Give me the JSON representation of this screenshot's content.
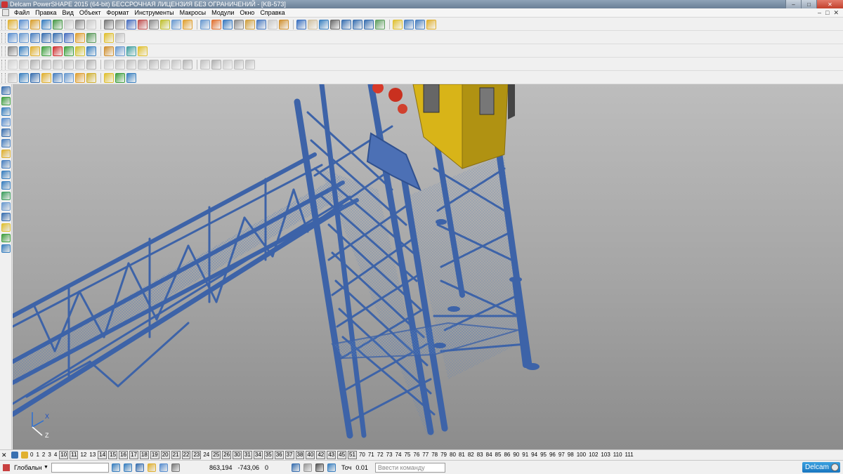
{
  "window": {
    "title": "Delcam PowerSHAPE 2015 (64-bit) БЕССРОЧНАЯ ЛИЦЕНЗИЯ БЕЗ ОГРАНИЧЕНИЙ - [KB-573]",
    "minimize": "–",
    "maximize": "□",
    "close": "✕"
  },
  "menu": {
    "items": [
      "Файл",
      "Правка",
      "Вид",
      "Объект",
      "Формат",
      "Инструменты",
      "Макросы",
      "Модули",
      "Окно",
      "Справка"
    ],
    "mdi": [
      "–",
      "□",
      "✕"
    ]
  },
  "toolbars": {
    "row1": [
      "#e0b030",
      "#5a8fd0",
      "#d9a030",
      "#3a7fc0",
      "#4a9a4a",
      "#c8c8c8",
      "#888",
      "#c8c8c8",
      "#777",
      "#999",
      "#4a70c0",
      "#c05050",
      "#8a8a8a",
      "#c0c030",
      "#6a9ad0",
      "#e0a030",
      "#6a9ad0",
      "#e07030",
      "#3a7ac0",
      "#8a8a8a",
      "#d0a040",
      "#4a7ac0",
      "#c8c8c8",
      "#d09030",
      "#3a70c0",
      "#d0c0a0",
      "#3a80c0",
      "#6a6a6a",
      "#3a70b0",
      "#3a70b0",
      "#3a70b0",
      "#60a060",
      "#e0c030",
      "#4a80c0",
      "#4a80c0",
      "#e0b030"
    ],
    "row2": [
      "#5a8fd0",
      "#6a9ad0",
      "#4a80c0",
      "#3a70b0",
      "#3a70b0",
      "#4a70c0",
      "#e0a030",
      "#5a9a5a",
      "#e0c030",
      "#c0c0c0"
    ],
    "row3": [
      "#888",
      "#3a80c0",
      "#e0b030",
      "#40a040",
      "#d03030",
      "#40a040",
      "#d0c030",
      "#3a80c0",
      "#d09030",
      "#6a9ad0",
      "#40a0a0",
      "#e0c030"
    ],
    "row4": [
      "#d0d0d0",
      "#c8c8c8",
      "#b0b0b0",
      "#b8b8b8",
      "#c0c0c0",
      "#bdbdbd",
      "#c0c0c0",
      "#b0b0b0",
      "#c8c8c8",
      "#c0c0c0",
      "#bcbcbc",
      "#c0c0c0",
      "#b8b8b8",
      "#c0c0c0",
      "#c4c4c4",
      "#b4b4b4",
      "#c0c0c0",
      "#b0b0b0",
      "#c8c8c8",
      "#bcbcbc",
      "#c0c0c0"
    ],
    "row5": [
      "#c0c0c0",
      "#3a80c0",
      "#3a70b0",
      "#e0b030",
      "#4a80c0",
      "#6a9ad0",
      "#e0a030",
      "#d0b030",
      "#e0c030",
      "#40a040",
      "#3a80c0"
    ]
  },
  "left_strip": [
    "#3a70b0",
    "#40a040",
    "#3a80c0",
    "#5a8fd0",
    "#3a70b0",
    "#4a80c0",
    "#e0b030",
    "#4a80c0",
    "#3a80c0",
    "#3a80c0",
    "#40a060",
    "#6a9ad0",
    "#3a70b0",
    "#e0c030",
    "#40a040",
    "#3a80c0"
  ],
  "viewport": {
    "background": "#a8a8a8",
    "axes": {
      "x": "X",
      "z": "Z"
    }
  },
  "levels": {
    "items": [
      "0",
      "1",
      "2",
      "3",
      "4",
      "10",
      "11",
      "12",
      "13",
      "14",
      "15",
      "16",
      "17",
      "18",
      "19",
      "20",
      "21",
      "22",
      "23",
      "24",
      "25",
      "26",
      "30",
      "31",
      "34",
      "35",
      "36",
      "37",
      "38",
      "40",
      "42",
      "43",
      "45",
      "51",
      "70",
      "71",
      "72",
      "73",
      "74",
      "75",
      "76",
      "77",
      "78",
      "79",
      "80",
      "81",
      "82",
      "83",
      "84",
      "85",
      "86",
      "90",
      "91",
      "94",
      "95",
      "96",
      "97",
      "98",
      "100",
      "102",
      "103",
      "110",
      "111"
    ],
    "active": [
      "10",
      "11",
      "14",
      "15",
      "16",
      "17",
      "18",
      "19",
      "20",
      "21",
      "22",
      "23",
      "25",
      "26",
      "30",
      "31",
      "34",
      "35",
      "36",
      "37",
      "38",
      "40",
      "42",
      "43",
      "45",
      "51"
    ]
  },
  "status": {
    "workplane": "Глобальн",
    "workplane_options": "",
    "x": "863,194",
    "y": "-743,06",
    "z": "0",
    "tolerance_label": "Точ",
    "tolerance_value": "0.01",
    "command_placeholder": "Ввести команду",
    "logo": "Delcam"
  }
}
